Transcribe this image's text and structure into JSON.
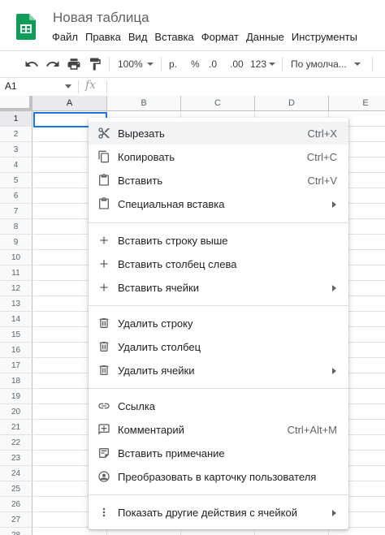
{
  "document": {
    "title": "Новая таблица"
  },
  "menu_bar": [
    "Файл",
    "Правка",
    "Вид",
    "Вставка",
    "Формат",
    "Данные",
    "Инструменты"
  ],
  "toolbar": {
    "zoom": "100%",
    "currency": "р.",
    "percent": "%",
    "dec_less": ".0",
    "dec_more": ".00",
    "num_format": "123",
    "font": "По умолча..."
  },
  "formula_bar": {
    "name_box": "A1",
    "fx": "fx",
    "value": ""
  },
  "columns": [
    "A",
    "B",
    "C",
    "D",
    "E"
  ],
  "rows": [
    "1",
    "2",
    "3",
    "4",
    "5",
    "6",
    "7",
    "8",
    "9",
    "10",
    "11",
    "12",
    "13",
    "14",
    "15",
    "16",
    "17",
    "18",
    "19",
    "20",
    "21",
    "22",
    "23",
    "24",
    "25",
    "26",
    "27",
    "28"
  ],
  "selected_cell": "A1",
  "context_menu": {
    "items": [
      {
        "label": "Вырезать",
        "shortcut": "Ctrl+X",
        "icon": "scissors-icon"
      },
      {
        "label": "Копировать",
        "shortcut": "Ctrl+C",
        "icon": "copy-icon"
      },
      {
        "label": "Вставить",
        "shortcut": "Ctrl+V",
        "icon": "clipboard-icon"
      },
      {
        "label": "Специальная вставка",
        "icon": "clipboard-icon",
        "submenu": true
      },
      {
        "label": "Вставить строку выше",
        "icon": "plus-icon"
      },
      {
        "label": "Вставить столбец слева",
        "icon": "plus-icon"
      },
      {
        "label": "Вставить ячейки",
        "icon": "plus-icon",
        "submenu": true
      },
      {
        "label": "Удалить строку",
        "icon": "trash-icon"
      },
      {
        "label": "Удалить столбец",
        "icon": "trash-icon"
      },
      {
        "label": "Удалить ячейки",
        "icon": "trash-icon",
        "submenu": true
      },
      {
        "label": "Ссылка",
        "icon": "link-icon"
      },
      {
        "label": "Комментарий",
        "shortcut": "Ctrl+Alt+M",
        "icon": "add-comment-icon"
      },
      {
        "label": "Вставить примечание",
        "icon": "note-icon"
      },
      {
        "label": "Преобразовать в карточку пользователя",
        "icon": "person-chip-icon"
      },
      {
        "label": "Показать другие действия с ячейкой",
        "icon": "more-vert-icon",
        "submenu": true
      }
    ]
  },
  "colors": {
    "sheets_green": "#0f9d58",
    "selection_blue": "#1a73e8",
    "menu_highlight": "#f1f3f4"
  }
}
